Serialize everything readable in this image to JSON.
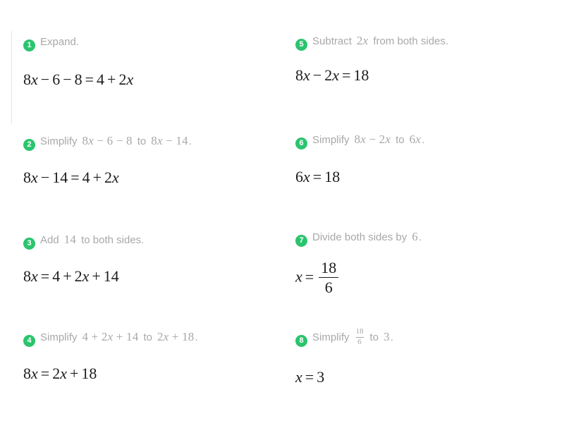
{
  "theme": {
    "badge_color": "#2bc46e",
    "badge_text_color": "#ffffff",
    "description_color": "#a8a8a8",
    "equation_color": "#1c1c1c",
    "background": "#ffffff",
    "rule_color": "#e6e6e6"
  },
  "problem": {
    "title": "Algebra equation solution steps"
  },
  "columns": [
    {
      "name": "left-column",
      "steps": [
        {
          "number": "1",
          "description_parts": [
            {
              "type": "text",
              "value": "Expand."
            }
          ],
          "equation_parts": [
            {
              "type": "num",
              "value": "8"
            },
            {
              "type": "var",
              "value": "x"
            },
            {
              "type": "op",
              "value": "−"
            },
            {
              "type": "num",
              "value": "6"
            },
            {
              "type": "op",
              "value": "−"
            },
            {
              "type": "num",
              "value": "8"
            },
            {
              "type": "op",
              "value": "="
            },
            {
              "type": "num",
              "value": "4"
            },
            {
              "type": "op",
              "value": "+"
            },
            {
              "type": "num",
              "value": "2"
            },
            {
              "type": "var",
              "value": "x"
            }
          ],
          "equation_text": "8x − 6 − 8 = 4 + 2x"
        },
        {
          "number": "2",
          "description_parts": [
            {
              "type": "text",
              "value": "Simplify"
            },
            {
              "type": "math",
              "value": "8x − 6 − 8"
            },
            {
              "type": "text",
              "value": "to"
            },
            {
              "type": "math",
              "value": "8x − 14"
            },
            {
              "type": "text",
              "value": "."
            }
          ],
          "equation_text": "8x − 14 = 4 + 2x"
        },
        {
          "number": "3",
          "description_parts": [
            {
              "type": "text",
              "value": "Add"
            },
            {
              "type": "math",
              "value": "14"
            },
            {
              "type": "text",
              "value": "to both sides."
            }
          ],
          "equation_text": "8x = 4 + 2x + 14"
        },
        {
          "number": "4",
          "description_parts": [
            {
              "type": "text",
              "value": "Simplify"
            },
            {
              "type": "math",
              "value": "4 + 2x + 14"
            },
            {
              "type": "text",
              "value": "to"
            },
            {
              "type": "math",
              "value": "2x + 18"
            },
            {
              "type": "text",
              "value": "."
            }
          ],
          "equation_text": "8x = 2x + 18"
        }
      ]
    },
    {
      "name": "right-column",
      "steps": [
        {
          "number": "5",
          "description_parts": [
            {
              "type": "text",
              "value": "Subtract"
            },
            {
              "type": "math",
              "value": "2x"
            },
            {
              "type": "text",
              "value": "from both sides."
            }
          ],
          "equation_text": "8x − 2x = 18"
        },
        {
          "number": "6",
          "description_parts": [
            {
              "type": "text",
              "value": "Simplify"
            },
            {
              "type": "math",
              "value": "8x − 2x"
            },
            {
              "type": "text",
              "value": "to"
            },
            {
              "type": "math",
              "value": "6x"
            },
            {
              "type": "text",
              "value": "."
            }
          ],
          "equation_text": "6x = 18"
        },
        {
          "number": "7",
          "description_parts": [
            {
              "type": "text",
              "value": "Divide both sides by"
            },
            {
              "type": "math",
              "value": "6"
            },
            {
              "type": "text",
              "value": "."
            }
          ],
          "equation_text": "x = 18/6",
          "fraction": {
            "numerator": "18",
            "denominator": "6"
          }
        },
        {
          "number": "8",
          "description_parts": [
            {
              "type": "text",
              "value": "Simplify"
            },
            {
              "type": "fraction",
              "numerator": "18",
              "denominator": "6"
            },
            {
              "type": "text",
              "value": "to"
            },
            {
              "type": "math",
              "value": "3"
            },
            {
              "type": "text",
              "value": "."
            }
          ],
          "equation_text": "x = 3"
        }
      ]
    }
  ],
  "labels": {
    "step1_desc": "Expand.",
    "step1_eq": "8x − 6 − 8 = 4 + 2x",
    "step2_simplify": "Simplify",
    "step2_from": "8x − 6 − 8",
    "step2_to_word": "to",
    "step2_to": "8x − 14",
    "step2_period": ".",
    "step2_eq": "8x − 14 = 4 + 2x",
    "step3_add": "Add",
    "step3_num": "14",
    "step3_rest": "to both sides.",
    "step3_eq": "8x = 4 + 2x + 14",
    "step4_simplify": "Simplify",
    "step4_from": "4 + 2x + 14",
    "step4_to_word": "to",
    "step4_to": "2x + 18",
    "step4_period": ".",
    "step4_eq": "8x = 2x + 18",
    "step5_sub": "Subtract",
    "step5_term": "2x",
    "step5_rest": "from both sides.",
    "step5_eq": "8x − 2x = 18",
    "step6_simplify": "Simplify",
    "step6_from": "8x − 2x",
    "step6_to_word": "to",
    "step6_to": "6x",
    "step6_period": ".",
    "step6_eq": "6x = 18",
    "step7_divide": "Divide both sides by",
    "step7_num": "6",
    "step7_period": ".",
    "step7_lhs": "x",
    "step7_eq_sign": "=",
    "step7_numerator": "18",
    "step7_denominator": "6",
    "step8_simplify": "Simplify",
    "step8_numerator": "18",
    "step8_denominator": "6",
    "step8_to_word": "to",
    "step8_to": "3",
    "step8_period": ".",
    "step8_eq": "x = 3",
    "badge1": "1",
    "badge2": "2",
    "badge3": "3",
    "badge4": "4",
    "badge5": "5",
    "badge6": "6",
    "badge7": "7",
    "badge8": "8"
  }
}
